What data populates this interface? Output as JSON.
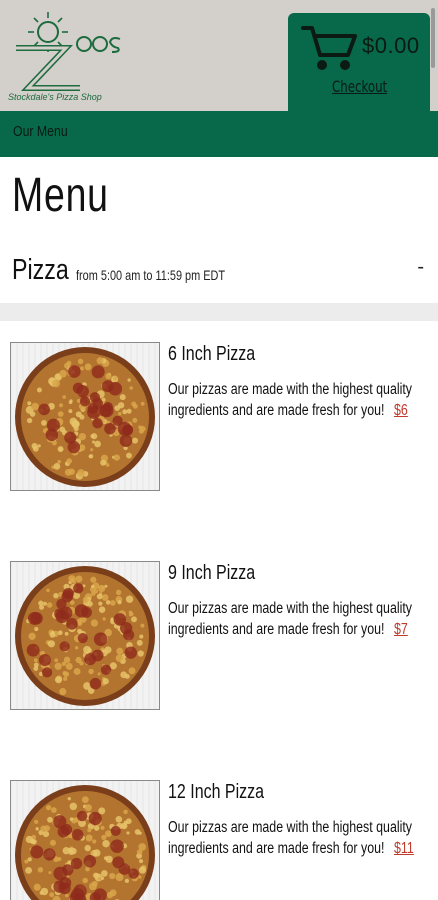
{
  "header": {
    "logo_icon": "zoos-sun-logo",
    "logo_text": "zoos",
    "logo_tagline": "Stockdale's Pizza Shop",
    "cart_total": "$0.00",
    "checkout_label": "Checkout",
    "accent_color": "#07694a"
  },
  "nav": {
    "items": [
      {
        "label": "Our Menu"
      }
    ]
  },
  "page": {
    "title": "Menu"
  },
  "section": {
    "title": "Pizza",
    "hours": "from 5:00 am to 11:59 pm EDT",
    "toggle": "-"
  },
  "items": [
    {
      "name": "6 Inch Pizza",
      "description": "Our pizzas are made with the highest quality ingredients and are made fresh for you!",
      "price": "$6"
    },
    {
      "name": "9 Inch Pizza",
      "description": "Our pizzas are made with the highest quality ingredients and are made fresh for you!",
      "price": "$7"
    },
    {
      "name": "12 Inch Pizza",
      "description": "Our pizzas are made with the highest quality ingredients and are made fresh for you!",
      "price": "$11"
    }
  ]
}
